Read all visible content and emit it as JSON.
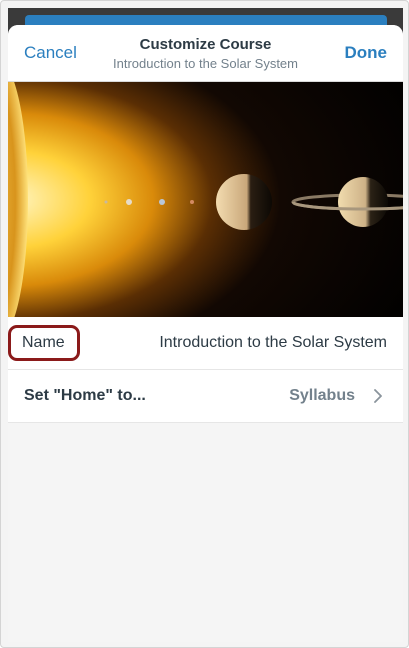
{
  "navbar": {
    "cancel_label": "Cancel",
    "title": "Customize Course",
    "subtitle": "Introduction to the Solar System",
    "done_label": "Done"
  },
  "course_image": {
    "description_icon": "solar-system-image"
  },
  "name_row": {
    "label": "Name",
    "value": "Introduction to the Solar System"
  },
  "home_row": {
    "label": "Set \"Home\" to...",
    "value": "Syllabus",
    "icon": "chevron-right-icon"
  },
  "colors": {
    "accent": "#2b7fbf",
    "highlight_border": "#8b1a1a",
    "text_primary": "#2d3b45",
    "text_secondary": "#73818c"
  }
}
